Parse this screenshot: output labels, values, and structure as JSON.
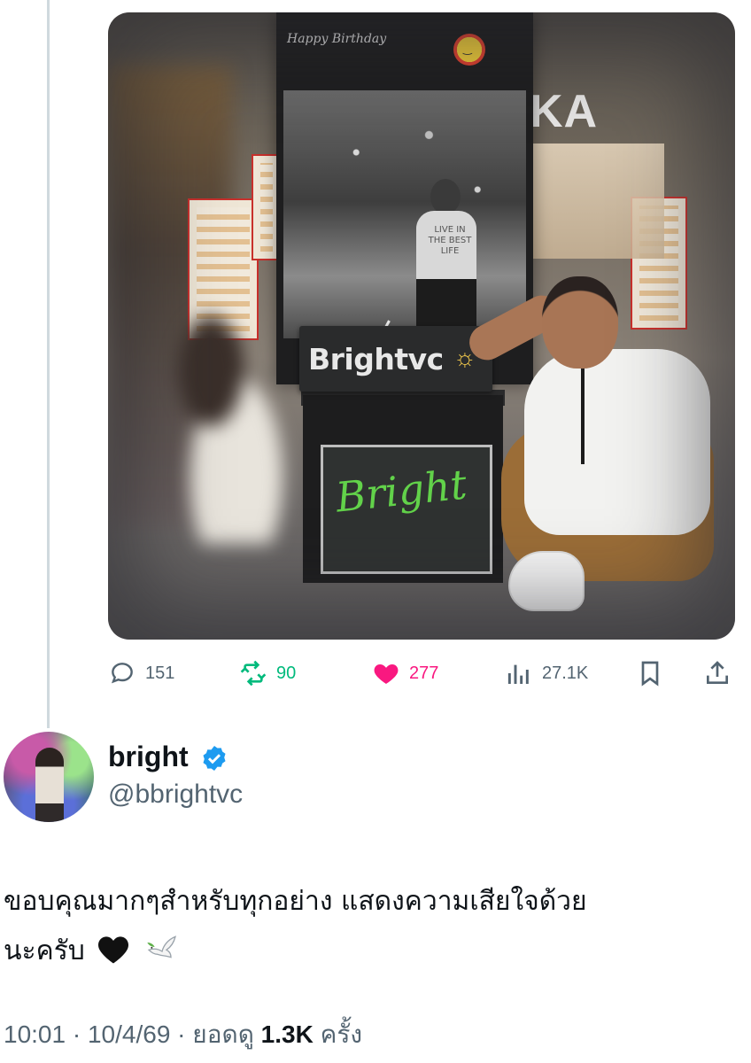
{
  "photo": {
    "sign_text": "Brightvc",
    "chalk_text": "Bright",
    "banner_text": "Happy Birthday",
    "jacket_text": "LIVE IN THE BEST LIFE",
    "store_sign": "KA"
  },
  "actions": {
    "replies": "151",
    "retweets": "90",
    "likes": "277",
    "views": "27.1K"
  },
  "author": {
    "name": "bright",
    "handle": "@bbrightvc",
    "verified": true
  },
  "tweet": {
    "line1": "ขอบคุณมากๆสำหรับทุกอย่าง แสดงความเสียใจด้วย",
    "line2": "นะครับ"
  },
  "meta": {
    "time": "10:01",
    "date": "10/4/69",
    "views_label": "ยอดดู",
    "views_count": "1.3K",
    "views_suffix": "ครั้ง"
  },
  "colors": {
    "reply": "#536471",
    "retweet": "#00ba7c",
    "like": "#f91880",
    "verified": "#1d9bf0"
  },
  "icons": [
    "reply-icon",
    "retweet-icon",
    "like-icon",
    "views-icon",
    "bookmark-icon",
    "share-icon",
    "verified-icon"
  ]
}
